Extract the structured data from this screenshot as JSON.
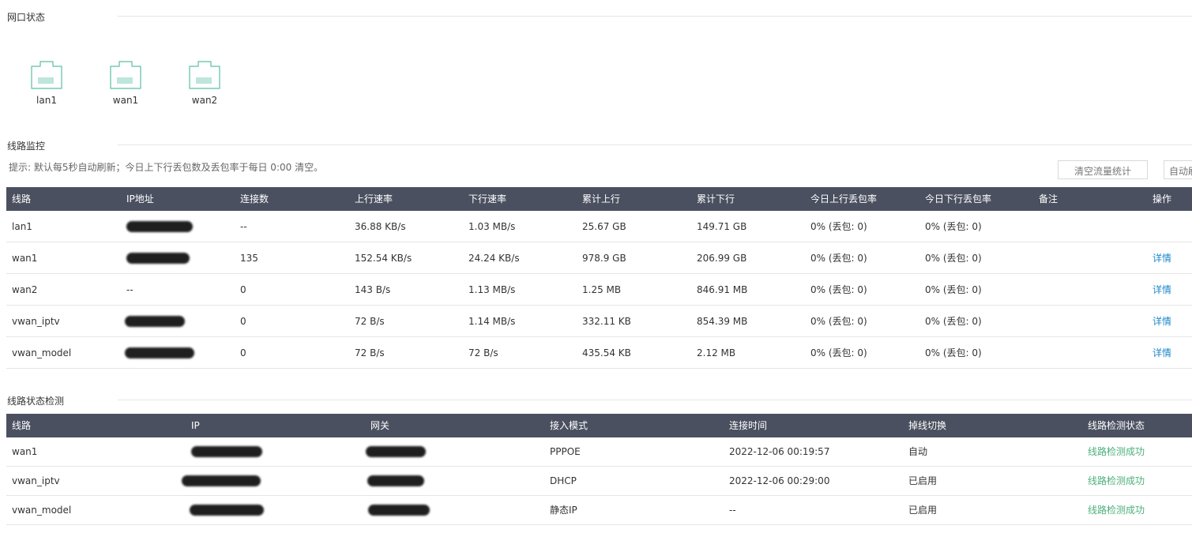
{
  "port_status": {
    "title": "网口状态",
    "ports": [
      {
        "name": "lan1",
        "icon": "ethernet-port-icon"
      },
      {
        "name": "wan1",
        "icon": "ethernet-port-icon"
      },
      {
        "name": "wan2",
        "icon": "ethernet-port-icon"
      }
    ]
  },
  "line_monitor": {
    "title": "线路监控",
    "tip": "提示: 默认每5秒自动刷新；今日上下行丢包数及丢包率于每日 0:00 清空。",
    "clear_button": "清空流量统计",
    "auto_refresh_button": "自动刷新",
    "columns": [
      "线路",
      "IP地址",
      "连接数",
      "上行速率",
      "下行速率",
      "累计上行",
      "累计下行",
      "今日上行丢包率",
      "今日下行丢包率",
      "备注",
      "操作"
    ],
    "rows": [
      {
        "line": "lan1",
        "ip": "",
        "connections": "--",
        "up_rate": "36.88 KB/s",
        "down_rate": "1.03 MB/s",
        "total_up": "25.67 GB",
        "total_down": "149.71 GB",
        "up_loss": "0% (丢包: 0)",
        "down_loss": "0% (丢包: 0)",
        "note": "",
        "action": ""
      },
      {
        "line": "wan1",
        "ip": "",
        "connections": "135",
        "up_rate": "152.54 KB/s",
        "down_rate": "24.24 KB/s",
        "total_up": "978.9 GB",
        "total_down": "206.99 GB",
        "up_loss": "0% (丢包: 0)",
        "down_loss": "0% (丢包: 0)",
        "note": "",
        "action": "详情"
      },
      {
        "line": "wan2",
        "ip": "--",
        "connections": "0",
        "up_rate": "143 B/s",
        "down_rate": "1.13 MB/s",
        "total_up": "1.25 MB",
        "total_down": "846.91 MB",
        "up_loss": "0% (丢包: 0)",
        "down_loss": "0% (丢包: 0)",
        "note": "",
        "action": "详情"
      },
      {
        "line": "vwan_iptv",
        "ip": "",
        "connections": "0",
        "up_rate": "72 B/s",
        "down_rate": "1.14 MB/s",
        "total_up": "332.11 KB",
        "total_down": "854.39 MB",
        "up_loss": "0% (丢包: 0)",
        "down_loss": "0% (丢包: 0)",
        "note": "",
        "action": "详情"
      },
      {
        "line": "vwan_model",
        "ip": "",
        "connections": "0",
        "up_rate": "72 B/s",
        "down_rate": "72 B/s",
        "total_up": "435.54 KB",
        "total_down": "2.12 MB",
        "up_loss": "0% (丢包: 0)",
        "down_loss": "0% (丢包: 0)",
        "note": "",
        "action": "详情"
      }
    ]
  },
  "line_detect": {
    "title": "线路状态检测",
    "columns": [
      "线路",
      "IP",
      "网关",
      "接入模式",
      "连接时间",
      "掉线切换",
      "线路检测状态"
    ],
    "rows": [
      {
        "line": "wan1",
        "ip": "",
        "gateway": "",
        "mode": "PPPOE",
        "conn_time": "2022-12-06 00:19:57",
        "failover": "自动",
        "status": "线路检测成功"
      },
      {
        "line": "vwan_iptv",
        "ip": "",
        "gateway": "",
        "mode": "DHCP",
        "conn_time": "2022-12-06 00:29:00",
        "failover": "已启用",
        "status": "线路检测成功"
      },
      {
        "line": "vwan_model",
        "ip": "",
        "gateway": "",
        "mode": "静态IP",
        "conn_time": "--",
        "failover": "已启用",
        "status": "线路检测成功"
      }
    ]
  },
  "colors": {
    "header_bg": "#4b5060",
    "link": "#1e88c9",
    "success": "#4caf7a",
    "port_icon": "#5bbfa6"
  }
}
